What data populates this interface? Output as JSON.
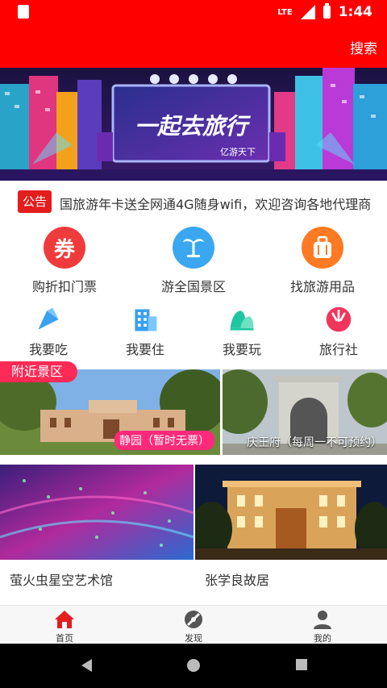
{
  "status": {
    "network": "LTE",
    "time": "1:44"
  },
  "appbar": {
    "search_label": "搜索"
  },
  "banner": {
    "headline": "一起去旅行",
    "subline": "亿游天下"
  },
  "notice": {
    "tag": "公告",
    "text": "国旅游年卡送全网通4G随身wifi，欢迎咨询各地代理商"
  },
  "categories_primary": [
    {
      "label": "购折扣门票",
      "icon": "ticket-coupon-icon",
      "glyph": "券",
      "color": "#ef3b3b"
    },
    {
      "label": "游全国景区",
      "icon": "palm-tree-icon",
      "glyph": "",
      "color": "#3aa7f0"
    },
    {
      "label": "找旅游用品",
      "icon": "luggage-icon",
      "glyph": "",
      "color": "#ff7a22"
    }
  ],
  "categories_secondary": [
    {
      "label": "我要吃",
      "icon": "food-cone-icon"
    },
    {
      "label": "我要住",
      "icon": "hotel-building-icon"
    },
    {
      "label": "我要玩",
      "icon": "mountain-icon"
    },
    {
      "label": "旅行社",
      "icon": "travel-agency-icon"
    }
  ],
  "nearby": {
    "title": "附近景区",
    "items": [
      {
        "caption": "静园（暂时无票）"
      },
      {
        "caption": "庆王府（每周一不可预约）"
      }
    ]
  },
  "cards": [
    {
      "name": "萤火虫星空艺术馆"
    },
    {
      "name": "张学良故居"
    }
  ],
  "tabs": [
    {
      "label": "首页",
      "icon": "home-icon"
    },
    {
      "label": "发现",
      "icon": "discover-icon"
    },
    {
      "label": "我的",
      "icon": "profile-icon"
    }
  ],
  "colors": {
    "brand_red": "#ff0000",
    "tag_pink": "#ff2a55"
  }
}
